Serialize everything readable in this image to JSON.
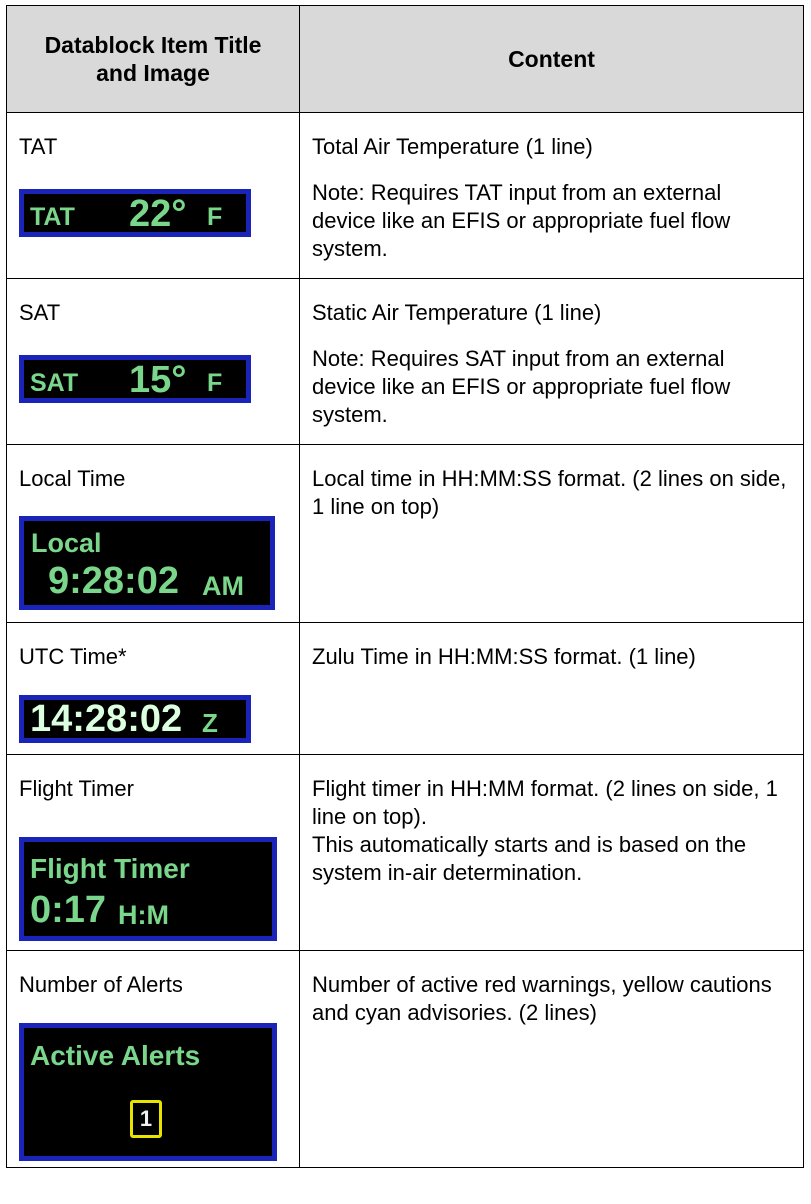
{
  "header": {
    "col1": "Datablock Item Title and Image",
    "col2": "Content"
  },
  "rows": [
    {
      "title": "TAT",
      "display": {
        "label": "TAT",
        "value": "22°",
        "unit": "F"
      },
      "content": "Total Air Temperature (1 line)",
      "note": "Note:  Requires TAT input from an external device like an EFIS or appropriate fuel flow system."
    },
    {
      "title": "SAT",
      "display": {
        "label": "SAT",
        "value": "15°",
        "unit": "F"
      },
      "content": "Static Air Temperature (1 line)",
      "note": "Note:  Requires SAT input from an external device like an EFIS or appropriate fuel flow system."
    },
    {
      "title": "Local Time",
      "display": {
        "label": "Local",
        "value": "9:28:02",
        "unit": "AM"
      },
      "content": "Local time in HH:MM:SS format. (2 lines on side, 1 line on top)"
    },
    {
      "title": "UTC Time*",
      "display": {
        "value": "14:28:02",
        "unit": "Z"
      },
      "content": "Zulu Time in HH:MM:SS format. (1 line)"
    },
    {
      "title": "Flight Timer",
      "display": {
        "label": "Flight Timer",
        "value": "0:17",
        "unit": "H:M"
      },
      "content": "Flight timer in HH:MM format. (2 lines on side, 1 line on top).",
      "content2": "This automatically starts and is based on the system in-air determination."
    },
    {
      "title": "Number of Alerts",
      "display": {
        "label": "Active Alerts",
        "value": "1"
      },
      "content": "Number of active red warnings, yellow cautions and cyan advisories.  (2 lines)"
    }
  ],
  "colors": {
    "display_bg": "#000000",
    "display_border": "#1a24b8",
    "display_text": "#79d68a",
    "display_value": "#e6ffe6",
    "alert_box": "#e8e400",
    "header_bg": "#d9d9d9"
  }
}
